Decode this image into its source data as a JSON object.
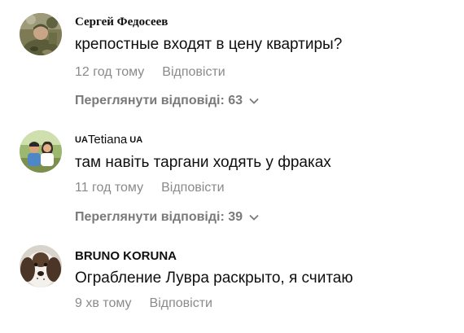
{
  "comments": [
    {
      "author": "Сергей Федосеев",
      "text": "крепостные входят в цену квартиры?",
      "time": "12 год тому",
      "reply_label": "Відповісти",
      "replies_label": "Переглянути відповіді: 63",
      "avatar": "person-in-camouflage-avatar"
    },
    {
      "author_prefix": "UA",
      "author": "Tetiana",
      "author_suffix": "UA",
      "text": "там навіть таргани ходять у фраках",
      "time": "11 год тому",
      "reply_label": "Відповісти",
      "replies_label": "Переглянути відповіді: 39",
      "avatar": "two-people-outdoors-avatar"
    },
    {
      "author": "BRUNO KORUNA",
      "text": "Ограбление Лувра раскрыто, я считаю",
      "time": "9 хв тому",
      "reply_label": "Відповісти",
      "avatar": "spaniel-dog-avatar"
    }
  ],
  "icons": {
    "expand": "chevron-down-icon"
  },
  "colors": {
    "text": "#0f0f0f",
    "meta": "#8a8a8a",
    "replies": "#7a7a7a"
  }
}
